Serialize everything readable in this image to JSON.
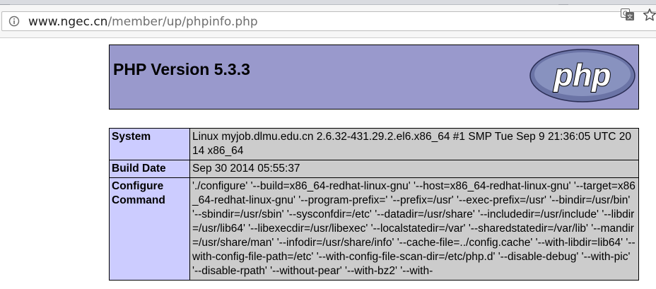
{
  "browser": {
    "url_host": "www.ngec.cn",
    "url_path": "/member/up/phpinfo.php"
  },
  "page": {
    "title": "PHP Version 5.3.3",
    "logo_text": "php",
    "rows": [
      {
        "label": "System",
        "value": "Linux myjob.dlmu.edu.cn 2.6.32-431.29.2.el6.x86_64 #1 SMP Tue Sep 9 21:36:05 UTC 2014 x86_64"
      },
      {
        "label": "Build Date",
        "value": "Sep 30 2014 05:55:37"
      },
      {
        "label": "Configure Command",
        "value": "'./configure' '--build=x86_64-redhat-linux-gnu' '--host=x86_64-redhat-linux-gnu' '--target=x86_64-redhat-linux-gnu' '--program-prefix=' '--prefix=/usr' '--exec-prefix=/usr' '--bindir=/usr/bin' '--sbindir=/usr/sbin' '--sysconfdir=/etc' '--datadir=/usr/share' '--includedir=/usr/include' '--libdir=/usr/lib64' '--libexecdir=/usr/libexec' '--localstatedir=/var' '--sharedstatedir=/var/lib' '--mandir=/usr/share/man' '--infodir=/usr/share/info' '--cache-file=../config.cache' '--with-libdir=lib64' '--with-config-file-path=/etc' '--with-config-file-scan-dir=/etc/php.d' '--disable-debug' '--with-pic' '--disable-rpath' '--without-pear' '--with-bz2' '--with-"
      }
    ]
  },
  "colors": {
    "header_bg": "#9999cc",
    "label_bg": "#ccccff",
    "value_bg": "#cccccc"
  }
}
